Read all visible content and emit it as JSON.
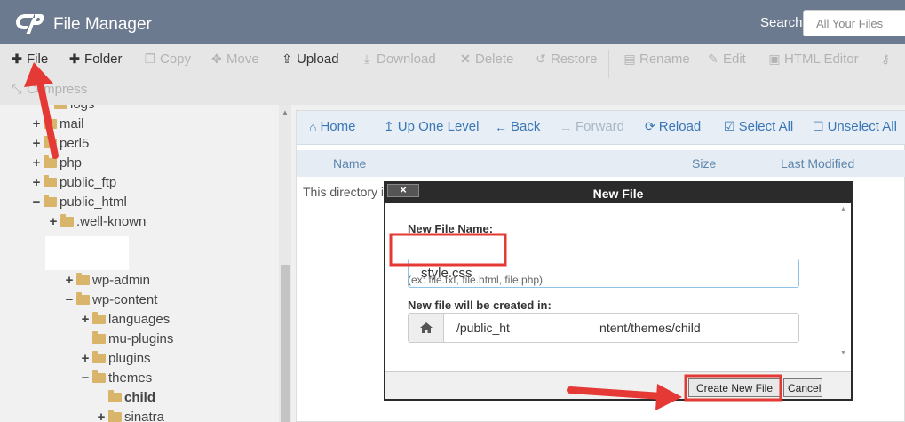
{
  "header": {
    "app_title": "File Manager",
    "search_label": "Search",
    "search_placeholder": "All Your Files"
  },
  "toolbar": [
    {
      "label": "File",
      "icon": "plus-icon",
      "enabled": true
    },
    {
      "label": "Folder",
      "icon": "plus-icon",
      "enabled": true
    },
    {
      "label": "Copy",
      "icon": "copy-icon",
      "enabled": false
    },
    {
      "label": "Move",
      "icon": "move-icon",
      "enabled": false
    },
    {
      "label": "Upload",
      "icon": "upload-icon",
      "enabled": true
    },
    {
      "label": "Download",
      "icon": "download-icon",
      "enabled": false
    },
    {
      "label": "Delete",
      "icon": "close-icon",
      "enabled": false
    },
    {
      "label": "Restore",
      "icon": "restore-icon",
      "enabled": false
    },
    {
      "label": "Rename",
      "icon": "document-icon",
      "enabled": false
    },
    {
      "label": "Edit",
      "icon": "pencil-icon",
      "enabled": false
    },
    {
      "label": "HTML Editor",
      "icon": "html-editor-icon",
      "enabled": false
    },
    {
      "label": "Permissions",
      "icon": "key-icon",
      "enabled": false
    },
    {
      "label": "Compress",
      "icon": "compress-icon",
      "enabled": false
    }
  ],
  "tree": [
    {
      "label": "logs",
      "toggle": ""
    },
    {
      "label": "mail",
      "toggle": "+"
    },
    {
      "label": "perl5",
      "toggle": "+"
    },
    {
      "label": "php",
      "toggle": "+"
    },
    {
      "label": "public_ftp",
      "toggle": "+"
    },
    {
      "label": "public_html",
      "toggle": "−"
    },
    {
      "label": ".well-known",
      "toggle": "+"
    },
    {
      "label": "wp-admin",
      "toggle": "+"
    },
    {
      "label": "wp-content",
      "toggle": "−"
    },
    {
      "label": "languages",
      "toggle": "+"
    },
    {
      "label": "mu-plugins",
      "toggle": ""
    },
    {
      "label": "plugins",
      "toggle": "+"
    },
    {
      "label": "themes",
      "toggle": "−"
    },
    {
      "label": "child",
      "toggle": ""
    },
    {
      "label": "sinatra",
      "toggle": "+"
    }
  ],
  "nav": [
    {
      "label": "Home",
      "icon": "home-icon",
      "enabled": true
    },
    {
      "label": "Up One Level",
      "icon": "up-arrow-icon",
      "enabled": true
    },
    {
      "label": "Back",
      "icon": "arrow-left-icon",
      "enabled": true
    },
    {
      "label": "Forward",
      "icon": "arrow-right-icon",
      "enabled": false
    },
    {
      "label": "Reload",
      "icon": "reload-icon",
      "enabled": true
    },
    {
      "label": "Select All",
      "icon": "checkbox-checked-icon",
      "enabled": true
    },
    {
      "label": "Unselect All",
      "icon": "checkbox-empty-icon",
      "enabled": true
    }
  ],
  "columns": {
    "name": "Name",
    "size": "Size",
    "modified": "Last Modified"
  },
  "empty_message": "This directory i",
  "dialog": {
    "title": "New File",
    "close": "×",
    "name_label": "New File Name:",
    "name_value": "style.css",
    "name_hint": "(ex: file.txt, file.html, file.php)",
    "path_label": "New file will be created in:",
    "path_value": "/public_ht                          ntent/themes/child",
    "create_button": "Create New File",
    "cancel_button": "Cancel"
  },
  "colors": {
    "header": "#6c7a8f",
    "accent": "#3a77b6",
    "highlight": "#e53935"
  }
}
